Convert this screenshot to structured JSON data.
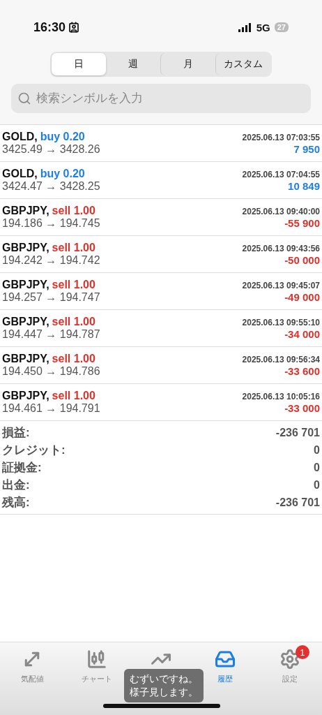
{
  "status_bar": {
    "time": "16:30",
    "network": "5G",
    "battery": "27"
  },
  "period_tabs": [
    {
      "label": "日",
      "selected": true
    },
    {
      "label": "週",
      "selected": false
    },
    {
      "label": "月",
      "selected": false
    },
    {
      "label": "カスタム",
      "selected": false
    }
  ],
  "search": {
    "placeholder": "検索シンボルを入力"
  },
  "trades": [
    {
      "symbol": "GOLD,",
      "kind": "buy",
      "order": "buy 0.20",
      "time": "2025.06.13 07:03:55",
      "prices": "3425.49 → 3428.26",
      "profit": "7 950",
      "color": "#1e7fe0"
    },
    {
      "symbol": "GOLD,",
      "kind": "buy",
      "order": "buy 0.20",
      "time": "2025.06.13 07:04:55",
      "prices": "3424.47 → 3428.25",
      "profit": "10 849",
      "color": "#1e7fe0"
    },
    {
      "symbol": "GBPJPY,",
      "kind": "sell",
      "order": "sell 1.00",
      "time": "2025.06.13 09:40:00",
      "prices": "194.186 → 194.745",
      "profit": "-55 900",
      "color": "#e0302a"
    },
    {
      "symbol": "GBPJPY,",
      "kind": "sell",
      "order": "sell 1.00",
      "time": "2025.06.13 09:43:56",
      "prices": "194.242 → 194.742",
      "profit": "-50 000",
      "color": "#e0302a"
    },
    {
      "symbol": "GBPJPY,",
      "kind": "sell",
      "order": "sell 1.00",
      "time": "2025.06.13 09:45:07",
      "prices": "194.257 → 194.747",
      "profit": "-49 000",
      "color": "#e0302a"
    },
    {
      "symbol": "GBPJPY,",
      "kind": "sell",
      "order": "sell 1.00",
      "time": "2025.06.13 09:55:10",
      "prices": "194.447 → 194.787",
      "profit": "-34 000",
      "color": "#e0302a"
    },
    {
      "symbol": "GBPJPY,",
      "kind": "sell",
      "order": "sell 1.00",
      "time": "2025.06.13 09:56:34",
      "prices": "194.450 → 194.786",
      "profit": "-33 600",
      "color": "#e0302a"
    },
    {
      "symbol": "GBPJPY,",
      "kind": "sell",
      "order": "sell 1.00",
      "time": "2025.06.13 10:05:16",
      "prices": "194.461 → 194.791",
      "profit": "-33 000",
      "color": "#e0302a"
    }
  ],
  "summary": [
    {
      "label": "損益:",
      "value": "-236 701"
    },
    {
      "label": "クレジット:",
      "value": "0"
    },
    {
      "label": "証拠金:",
      "value": "0"
    },
    {
      "label": "出金:",
      "value": "0"
    },
    {
      "label": "残高:",
      "value": "-236 701"
    }
  ],
  "tab_bar": [
    {
      "kind": "quotes",
      "label": "気配値",
      "selected": false
    },
    {
      "kind": "chart",
      "label": "チャート",
      "selected": false
    },
    {
      "kind": "trade",
      "selected": false
    },
    {
      "kind": "history",
      "label": "履歴",
      "selected": true
    },
    {
      "kind": "settings",
      "label": "設定",
      "selected": false,
      "badge": "1"
    }
  ],
  "caption": {
    "lines": [
      "むずいですね。",
      "様子見します。"
    ]
  }
}
